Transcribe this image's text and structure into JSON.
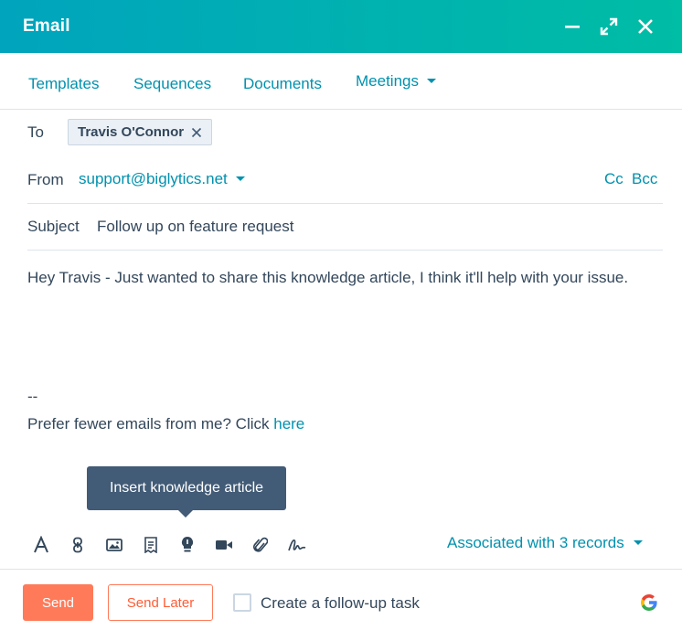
{
  "header": {
    "title": "Email"
  },
  "tabs": [
    {
      "label": "Templates"
    },
    {
      "label": "Sequences"
    },
    {
      "label": "Documents"
    },
    {
      "label": "Meetings"
    }
  ],
  "to": {
    "label": "To",
    "recipient": "Travis O'Connor"
  },
  "from": {
    "label": "From",
    "value": "support@biglytics.net",
    "cc": "Cc",
    "bcc": "Bcc"
  },
  "subject": {
    "label": "Subject",
    "value": "Follow up on feature request"
  },
  "body": {
    "text": "Hey Travis - Just wanted to share this knowledge article, I think it'll help with your issue.",
    "signature_dash": "--",
    "signature_text": "Prefer fewer emails from me? Click ",
    "signature_link": "here"
  },
  "tooltip": {
    "text": "Insert knowledge article"
  },
  "toolbar": {
    "icons": [
      "text-format-icon",
      "link-icon",
      "image-icon",
      "snippet-icon",
      "knowledge-article-icon",
      "video-icon",
      "attachment-icon",
      "signature-icon"
    ],
    "associated": "Associated with 3 records"
  },
  "footer": {
    "send": "Send",
    "send_later": "Send Later",
    "followup_label": "Create a follow-up task"
  },
  "colors": {
    "header_start": "#00a4bd",
    "header_end": "#00bda5",
    "link": "#0091ae",
    "primary_button": "#ff7a59",
    "tooltip": "#425b76",
    "text": "#33475b"
  }
}
